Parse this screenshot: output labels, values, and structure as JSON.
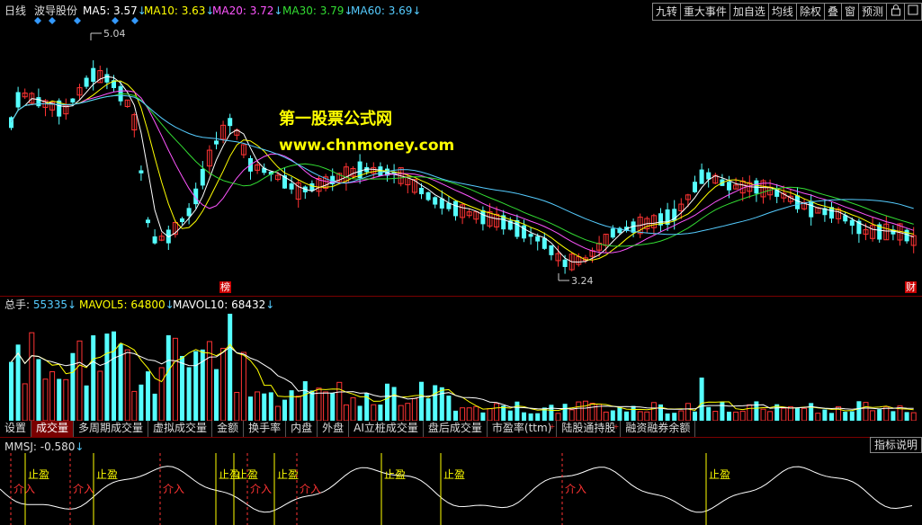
{
  "header": {
    "period": "日线",
    "stock_name": "波导股份",
    "ma": [
      {
        "label": "MA5: 3.57",
        "arrow": "↓",
        "color": "#ffffff"
      },
      {
        "label": "MA10: 3.63",
        "arrow": "↓",
        "color": "#ffff00"
      },
      {
        "label": "MA20: 3.72",
        "arrow": "↓",
        "color": "#ff55ff"
      },
      {
        "label": "MA30: 3.79",
        "arrow": "↓",
        "color": "#33dd33"
      },
      {
        "label": "MA60: 3.69",
        "arrow": "↓",
        "color": "#55ccff"
      }
    ]
  },
  "toolbar": {
    "buttons": [
      "九转",
      "重大事件",
      "加自选",
      "均线",
      "除权",
      "叠",
      "窗",
      "预测"
    ],
    "lock_icon": "lock-icon",
    "close_icon": "close-icon"
  },
  "main_chart": {
    "high_label": "5.04",
    "low_label": "3.24",
    "tag_bang": "榜",
    "tag_cai": "财",
    "watermark_title": "第一股票公式网",
    "watermark_url": "www.chnmoney.com"
  },
  "volume_header": {
    "items": [
      {
        "label": "总手: ",
        "value": "55335",
        "arrow": "↓",
        "color": "#55ccff"
      },
      {
        "label": "MAVOL5: ",
        "value": "64800",
        "arrow": "↓",
        "color": "#ffff00"
      },
      {
        "label": "MAVOL10: ",
        "value": "68432",
        "arrow": "↓",
        "color": "#ffffff"
      }
    ]
  },
  "tabs": [
    {
      "label": "设置",
      "active": false,
      "plus": false
    },
    {
      "label": "成交量",
      "active": true,
      "plus": false
    },
    {
      "label": "多周期成交量",
      "active": false,
      "plus": false
    },
    {
      "label": "虚拟成交量",
      "active": false,
      "plus": false
    },
    {
      "label": "金额",
      "active": false,
      "plus": false
    },
    {
      "label": "换手率",
      "active": false,
      "plus": false
    },
    {
      "label": "内盘",
      "active": false,
      "plus": false
    },
    {
      "label": "外盘",
      "active": false,
      "plus": false
    },
    {
      "label": "AI立桩成交量",
      "active": false,
      "plus": false
    },
    {
      "label": "盘后成交量",
      "active": false,
      "plus": false
    },
    {
      "label": "市盈率(ttm)",
      "active": false,
      "plus": true
    },
    {
      "label": "陆股通持股",
      "active": false,
      "plus": true
    },
    {
      "label": "融资融券余额",
      "active": false,
      "plus": false
    }
  ],
  "mmsj": {
    "name": "MMSJ:",
    "value": "-0.580",
    "arrow": "↓",
    "help_button": "指标说明",
    "label_take_profit": "止盈",
    "label_buy_in": "介入"
  },
  "colors": {
    "up": "#ff3333",
    "down": "#55ffff",
    "ma5": "#ffffff",
    "ma10": "#ffff00",
    "ma20": "#ff55ff",
    "ma30": "#33dd33",
    "ma60": "#55ccff",
    "grid": "#7a0000"
  }
}
